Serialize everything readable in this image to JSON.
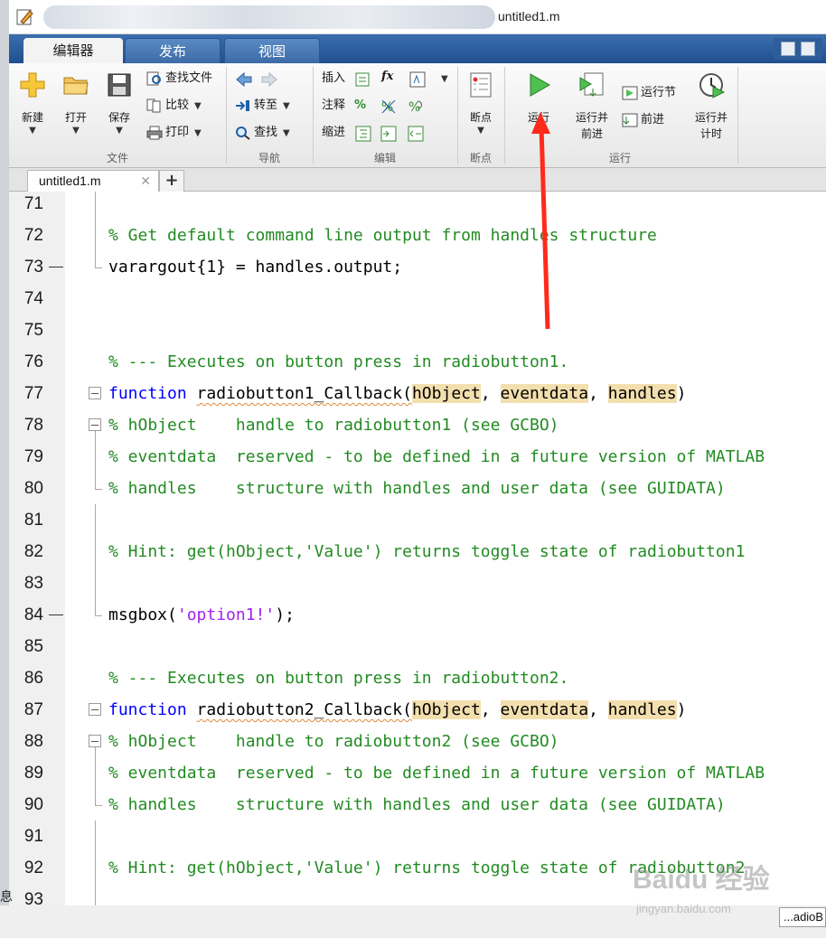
{
  "window": {
    "title": "untitled1.m"
  },
  "ribbon": {
    "tabs": [
      "编辑器",
      "发布",
      "视图"
    ],
    "file": {
      "section": "文件",
      "new": "新建",
      "open": "打开",
      "save": "保存",
      "find_files": "查找文件",
      "compare": "比较",
      "print": "打印"
    },
    "navigate": {
      "section": "导航",
      "goto": "转至",
      "find": "查找"
    },
    "edit": {
      "section": "编辑",
      "insert": "插入",
      "comment": "注释",
      "indent": "缩进",
      "fx": "fx"
    },
    "breakpoints": {
      "section": "断点",
      "breakpoints": "断点"
    },
    "run": {
      "section": "运行",
      "run": "运行",
      "run_advance_l1": "运行并",
      "run_advance_l2": "前进",
      "run_section": "运行节",
      "advance": "前进",
      "run_time_l1": "运行并",
      "run_time_l2": "计时"
    }
  },
  "editor": {
    "tab": "untitled1.m",
    "add_tab": "+",
    "lines": [
      {
        "n": "71"
      },
      {
        "n": "72",
        "parts": [
          {
            "c": "cm",
            "t": "% Get default command line output from handles structure"
          }
        ]
      },
      {
        "n": "73",
        "parts": [
          {
            "c": "tx",
            "t": "varargout{1} = handles.output;"
          }
        ]
      },
      {
        "n": "74"
      },
      {
        "n": "75"
      },
      {
        "n": "76",
        "parts": [
          {
            "c": "cm",
            "t": "% --- Executes on button press in radiobutton1."
          }
        ]
      },
      {
        "n": "77",
        "parts": [
          {
            "c": "kw",
            "t": "function "
          },
          {
            "c": "tx",
            "t": "radiobutton1_Callback("
          },
          {
            "c": "tx hl",
            "t": "hObject"
          },
          {
            "c": "tx",
            "t": ", "
          },
          {
            "c": "tx hl",
            "t": "eventdata"
          },
          {
            "c": "tx",
            "t": ", "
          },
          {
            "c": "tx hl",
            "t": "handles"
          },
          {
            "c": "tx",
            "t": ")"
          }
        ]
      },
      {
        "n": "78",
        "parts": [
          {
            "c": "cm",
            "t": "% hObject    handle to radiobutton1 (see GCBO)"
          }
        ]
      },
      {
        "n": "79",
        "parts": [
          {
            "c": "cm",
            "t": "% eventdata  reserved - to be defined in a future version of MATLAB"
          }
        ]
      },
      {
        "n": "80",
        "parts": [
          {
            "c": "cm",
            "t": "% handles    structure with handles and user data (see GUIDATA)"
          }
        ]
      },
      {
        "n": "81"
      },
      {
        "n": "82",
        "parts": [
          {
            "c": "cm",
            "t": "% Hint: get(hObject,'Value') returns toggle state of radiobutton1"
          }
        ]
      },
      {
        "n": "83"
      },
      {
        "n": "84",
        "parts": [
          {
            "c": "tx",
            "t": "msgbox("
          },
          {
            "c": "st",
            "t": "'option1!'"
          },
          {
            "c": "tx",
            "t": ");"
          }
        ]
      },
      {
        "n": "85"
      },
      {
        "n": "86",
        "parts": [
          {
            "c": "cm",
            "t": "% --- Executes on button press in radiobutton2."
          }
        ]
      },
      {
        "n": "87",
        "parts": [
          {
            "c": "kw",
            "t": "function "
          },
          {
            "c": "tx",
            "t": "radiobutton2_Callback("
          },
          {
            "c": "tx hl",
            "t": "hObject"
          },
          {
            "c": "tx",
            "t": ", "
          },
          {
            "c": "tx hl",
            "t": "eventdata"
          },
          {
            "c": "tx",
            "t": ", "
          },
          {
            "c": "tx hl",
            "t": "handles"
          },
          {
            "c": "tx",
            "t": ")"
          }
        ]
      },
      {
        "n": "88",
        "parts": [
          {
            "c": "cm",
            "t": "% hObject    handle to radiobutton2 (see GCBO)"
          }
        ]
      },
      {
        "n": "89",
        "parts": [
          {
            "c": "cm",
            "t": "% eventdata  reserved - to be defined in a future version of MATLAB"
          }
        ]
      },
      {
        "n": "90",
        "parts": [
          {
            "c": "cm",
            "t": "% handles    structure with handles and user data (see GUIDATA)"
          }
        ]
      },
      {
        "n": "91"
      },
      {
        "n": "92",
        "parts": [
          {
            "c": "cm",
            "t": "% Hint: get(hObject,'Value') returns toggle state of radiobutton2"
          }
        ]
      },
      {
        "n": "93"
      }
    ]
  },
  "status": {
    "function_name": "...adioB"
  },
  "watermark": {
    "brand": "Baidu 经验",
    "url": "jingyan.baidu.com"
  },
  "colors": {
    "comment": "#228b22",
    "keyword": "#0000ff",
    "string": "#a020f0",
    "highlight": "#f3dfae",
    "annotation_arrow": "#ff2a1a"
  }
}
